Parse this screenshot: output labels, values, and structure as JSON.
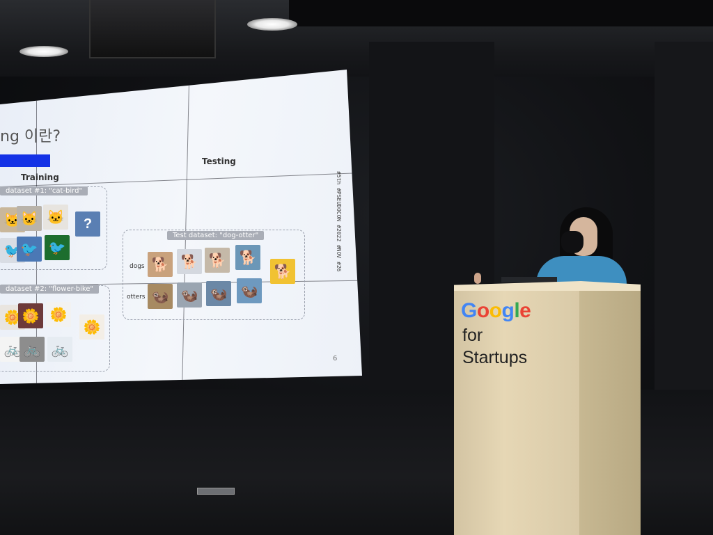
{
  "slide": {
    "title_fragment": "ng 이란?",
    "training_label": "Training",
    "testing_label": "Testing",
    "dataset1_label": "dataset #1: \"cat-bird\"",
    "dataset2_label": "dataset #2: \"flower-bike\"",
    "test_dataset_label": "Test dataset: \"dog-otter\"",
    "row_dogs": "dogs",
    "row_otters": "otters",
    "page_number": "6",
    "vertical_tag": "#5th #PSEUDOCON #2022 #NOV #26",
    "question_mark": "?"
  },
  "podium": {
    "brand_letters": [
      "G",
      "o",
      "o",
      "g",
      "l",
      "e"
    ],
    "brand_colors": [
      "#4285F4",
      "#EA4335",
      "#FBBC05",
      "#4285F4",
      "#34A853",
      "#EA4335"
    ],
    "line2": "for",
    "line3": "Startups"
  },
  "icons": {
    "cat": "🐱",
    "bird": "🐦",
    "flower": "🌼",
    "bike": "🚲",
    "dog": "🐕",
    "otter": "🦦"
  }
}
